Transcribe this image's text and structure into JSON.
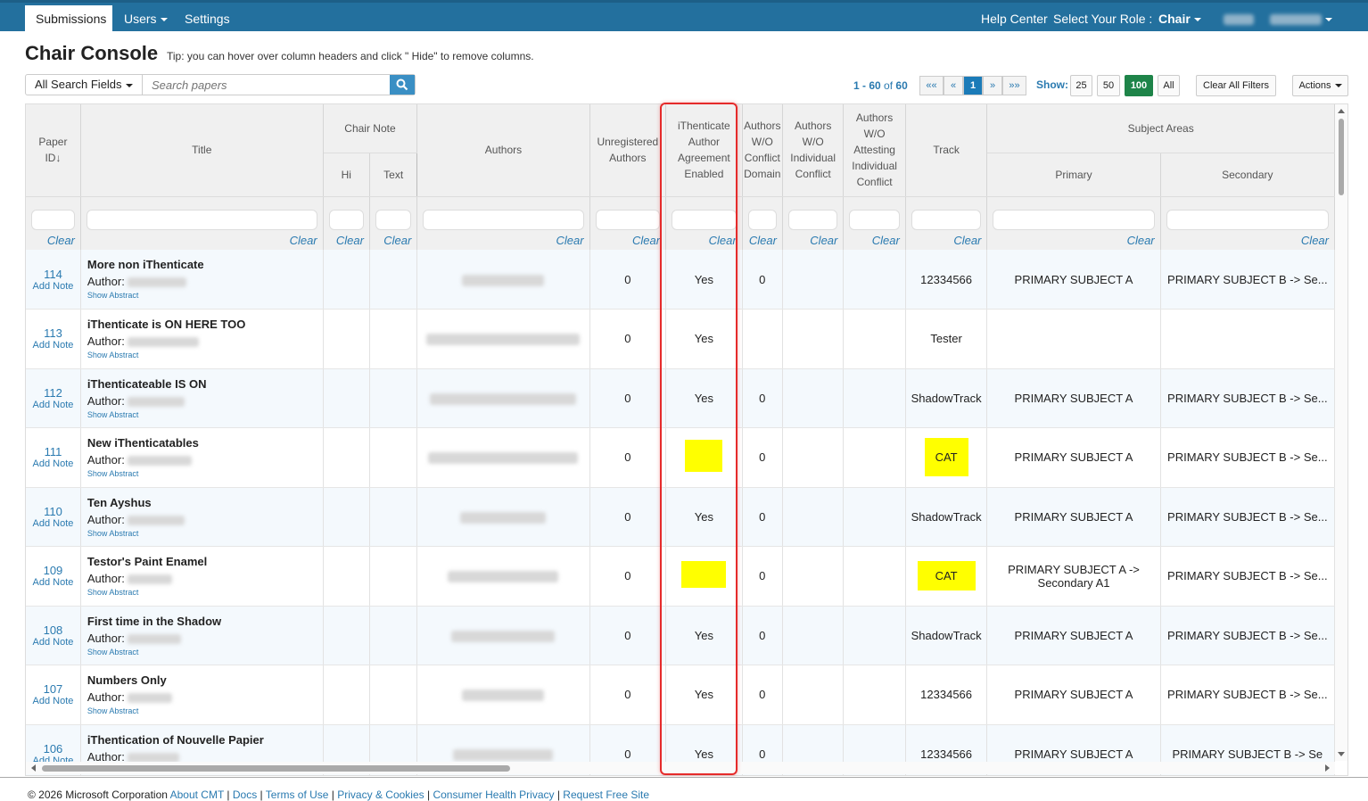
{
  "nav": {
    "tabs": [
      {
        "label": "Submissions"
      },
      {
        "label": "Users"
      },
      {
        "label": "Settings"
      }
    ],
    "help": "Help Center",
    "role_label": "Select Your Role :",
    "role": "Chair"
  },
  "page": {
    "title": "Chair Console",
    "tip": "Tip: you can hover over column headers and click \" Hide\" to remove columns."
  },
  "search": {
    "field": "All Search Fields",
    "placeholder": "Search papers"
  },
  "pager": {
    "range": "1 - 60",
    "of": "of",
    "total": "60",
    "first": "«« ",
    "prev": "«",
    "current": "1",
    "next": "»",
    "last": "»»",
    "show_label": "Show:",
    "sizes": [
      "25",
      "50",
      "100",
      "All"
    ],
    "clear_filters": "Clear All Filters",
    "actions": "Actions"
  },
  "columns": {
    "paper_id": "Paper ID↓",
    "title": "Title",
    "chair_note": "Chair Note",
    "hi": "Hi",
    "text": "Text",
    "authors": "Authors",
    "unregistered": "Unregistered Authors",
    "ithenticate": "iThenticate Author Agreement Enabled",
    "wo_domain": "Authors W/O Conflict Domain",
    "wo_individual": "Authors W/O Individual Conflict",
    "wo_attesting": "Authors W/O Attesting Individual Conflict",
    "track": "Track",
    "subject_areas": "Subject Areas",
    "primary": "Primary",
    "secondary": "Secondary",
    "clear": "Clear"
  },
  "row_labels": {
    "add_note": "Add Note",
    "author": "Author:",
    "show_abstract": "Show Abstract"
  },
  "rows": [
    {
      "id": "114",
      "title": "More non iThenticate",
      "unreg": "0",
      "ith": "Yes",
      "wo_domain": "0",
      "track": "12334566",
      "primary": "PRIMARY SUBJECT A",
      "secondary": "PRIMARY SUBJECT B -> Se..."
    },
    {
      "id": "113",
      "title": "iThenticate is ON HERE TOO",
      "unreg": "0",
      "ith": "Yes",
      "wo_domain": "",
      "track": "Tester",
      "primary": "",
      "secondary": ""
    },
    {
      "id": "112",
      "title": "iThenticateable IS ON",
      "unreg": "0",
      "ith": "Yes",
      "wo_domain": "0",
      "track": "ShadowTrack",
      "primary": "PRIMARY SUBJECT A",
      "secondary": "PRIMARY SUBJECT B -> Se..."
    },
    {
      "id": "111",
      "title": "New iThenticatables",
      "unreg": "0",
      "ith": "",
      "ith_highlight": true,
      "wo_domain": "0",
      "track": "CAT",
      "track_highlight": true,
      "primary": "PRIMARY SUBJECT A",
      "secondary": "PRIMARY SUBJECT B -> Se..."
    },
    {
      "id": "110",
      "title": "Ten Ayshus",
      "unreg": "0",
      "ith": "Yes",
      "wo_domain": "0",
      "track": "ShadowTrack",
      "primary": "PRIMARY SUBJECT A",
      "secondary": "PRIMARY SUBJECT B -> Se..."
    },
    {
      "id": "109",
      "title": "Testor's Paint Enamel",
      "unreg": "0",
      "ith": "",
      "ith_highlight": true,
      "wo_domain": "0",
      "track": "CAT",
      "track_highlight": true,
      "primary": "PRIMARY SUBJECT A -> Secondary A1",
      "secondary": "PRIMARY SUBJECT B -> Se..."
    },
    {
      "id": "108",
      "title": "First time in the Shadow",
      "unreg": "0",
      "ith": "Yes",
      "wo_domain": "0",
      "track": "ShadowTrack",
      "primary": "PRIMARY SUBJECT A",
      "secondary": "PRIMARY SUBJECT B -> Se..."
    },
    {
      "id": "107",
      "title": "Numbers Only",
      "unreg": "0",
      "ith": "Yes",
      "wo_domain": "0",
      "track": "12334566",
      "primary": "PRIMARY SUBJECT A",
      "secondary": "PRIMARY SUBJECT B -> Se..."
    },
    {
      "id": "106",
      "title": "iThentication of Nouvelle Papier",
      "unreg": "0",
      "ith": "Yes",
      "wo_domain": "0",
      "track": "12334566",
      "primary": "PRIMARY SUBJECT A",
      "secondary": "PRIMARY SUBJECT B -> Se"
    }
  ],
  "footer": {
    "copyright": "© 2026 Microsoft Corporation",
    "links": [
      "About CMT",
      "Docs",
      "Terms of Use",
      "Privacy & Cookies",
      "Consumer Health Privacy",
      "Request Free Site"
    ]
  },
  "colors": {
    "nav": "#23709e",
    "highlight": "#ffff00",
    "annotation": "#e52b2b",
    "active_size": "#1e8449"
  }
}
